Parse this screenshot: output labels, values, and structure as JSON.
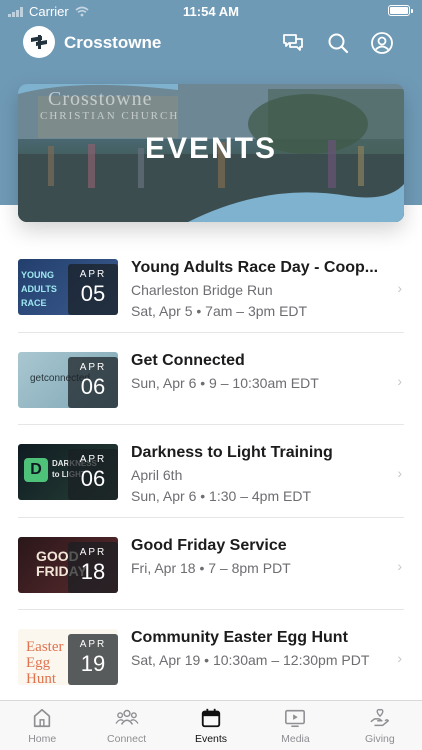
{
  "status_bar": {
    "carrier": "Carrier",
    "time": "11:54 AM"
  },
  "header": {
    "title": "Crosstowne",
    "icons": [
      "chat-icon",
      "search-icon",
      "profile-icon"
    ]
  },
  "hero": {
    "title": "EVENTS",
    "sign_text_1": "Crosstowne",
    "sign_text_2": "CHRISTIAN CHURCH"
  },
  "events": [
    {
      "month": "APR",
      "day": "05",
      "title": "Young Adults Race Day - Coop...",
      "line1": "Charleston Bridge Run",
      "line2": "Sat, Apr 5 • 7am – 3pm EDT",
      "thumb_text": "YOUNG ADULTS RACE"
    },
    {
      "month": "APR",
      "day": "06",
      "title": "Get Connected",
      "line1": "Sun, Apr 6 • 9 – 10:30am EDT",
      "line2": "",
      "thumb_text": "getconnected"
    },
    {
      "month": "APR",
      "day": "06",
      "title": "Darkness to Light Training",
      "line1": "April 6th",
      "line2": "Sun, Apr 6 • 1:30 – 4pm EDT",
      "thumb_text": "DARKNESS to LIGHT"
    },
    {
      "month": "APR",
      "day": "18",
      "title": "Good Friday Service",
      "line1": "Fri, Apr 18 • 7 – 8pm PDT",
      "line2": "",
      "thumb_text": "GOOD FRIDAY"
    },
    {
      "month": "APR",
      "day": "19",
      "title": "Community Easter Egg Hunt",
      "line1": "Sat, Apr 19 • 10:30am – 12:30pm PDT",
      "line2": "",
      "thumb_text": "Easter Egg Hunt"
    }
  ],
  "tabs": [
    {
      "label": "Home",
      "icon": "home-icon",
      "active": false
    },
    {
      "label": "Connect",
      "icon": "people-icon",
      "active": false
    },
    {
      "label": "Events",
      "icon": "calendar-icon",
      "active": true
    },
    {
      "label": "Media",
      "icon": "video-icon",
      "active": false
    },
    {
      "label": "Giving",
      "icon": "giving-hand-icon",
      "active": false
    }
  ],
  "colors": {
    "header_blue": "#6f9ab6",
    "wave_blue": "#7fb2cf",
    "tab_active": "#111111",
    "tab_inactive": "#8e8e93"
  }
}
